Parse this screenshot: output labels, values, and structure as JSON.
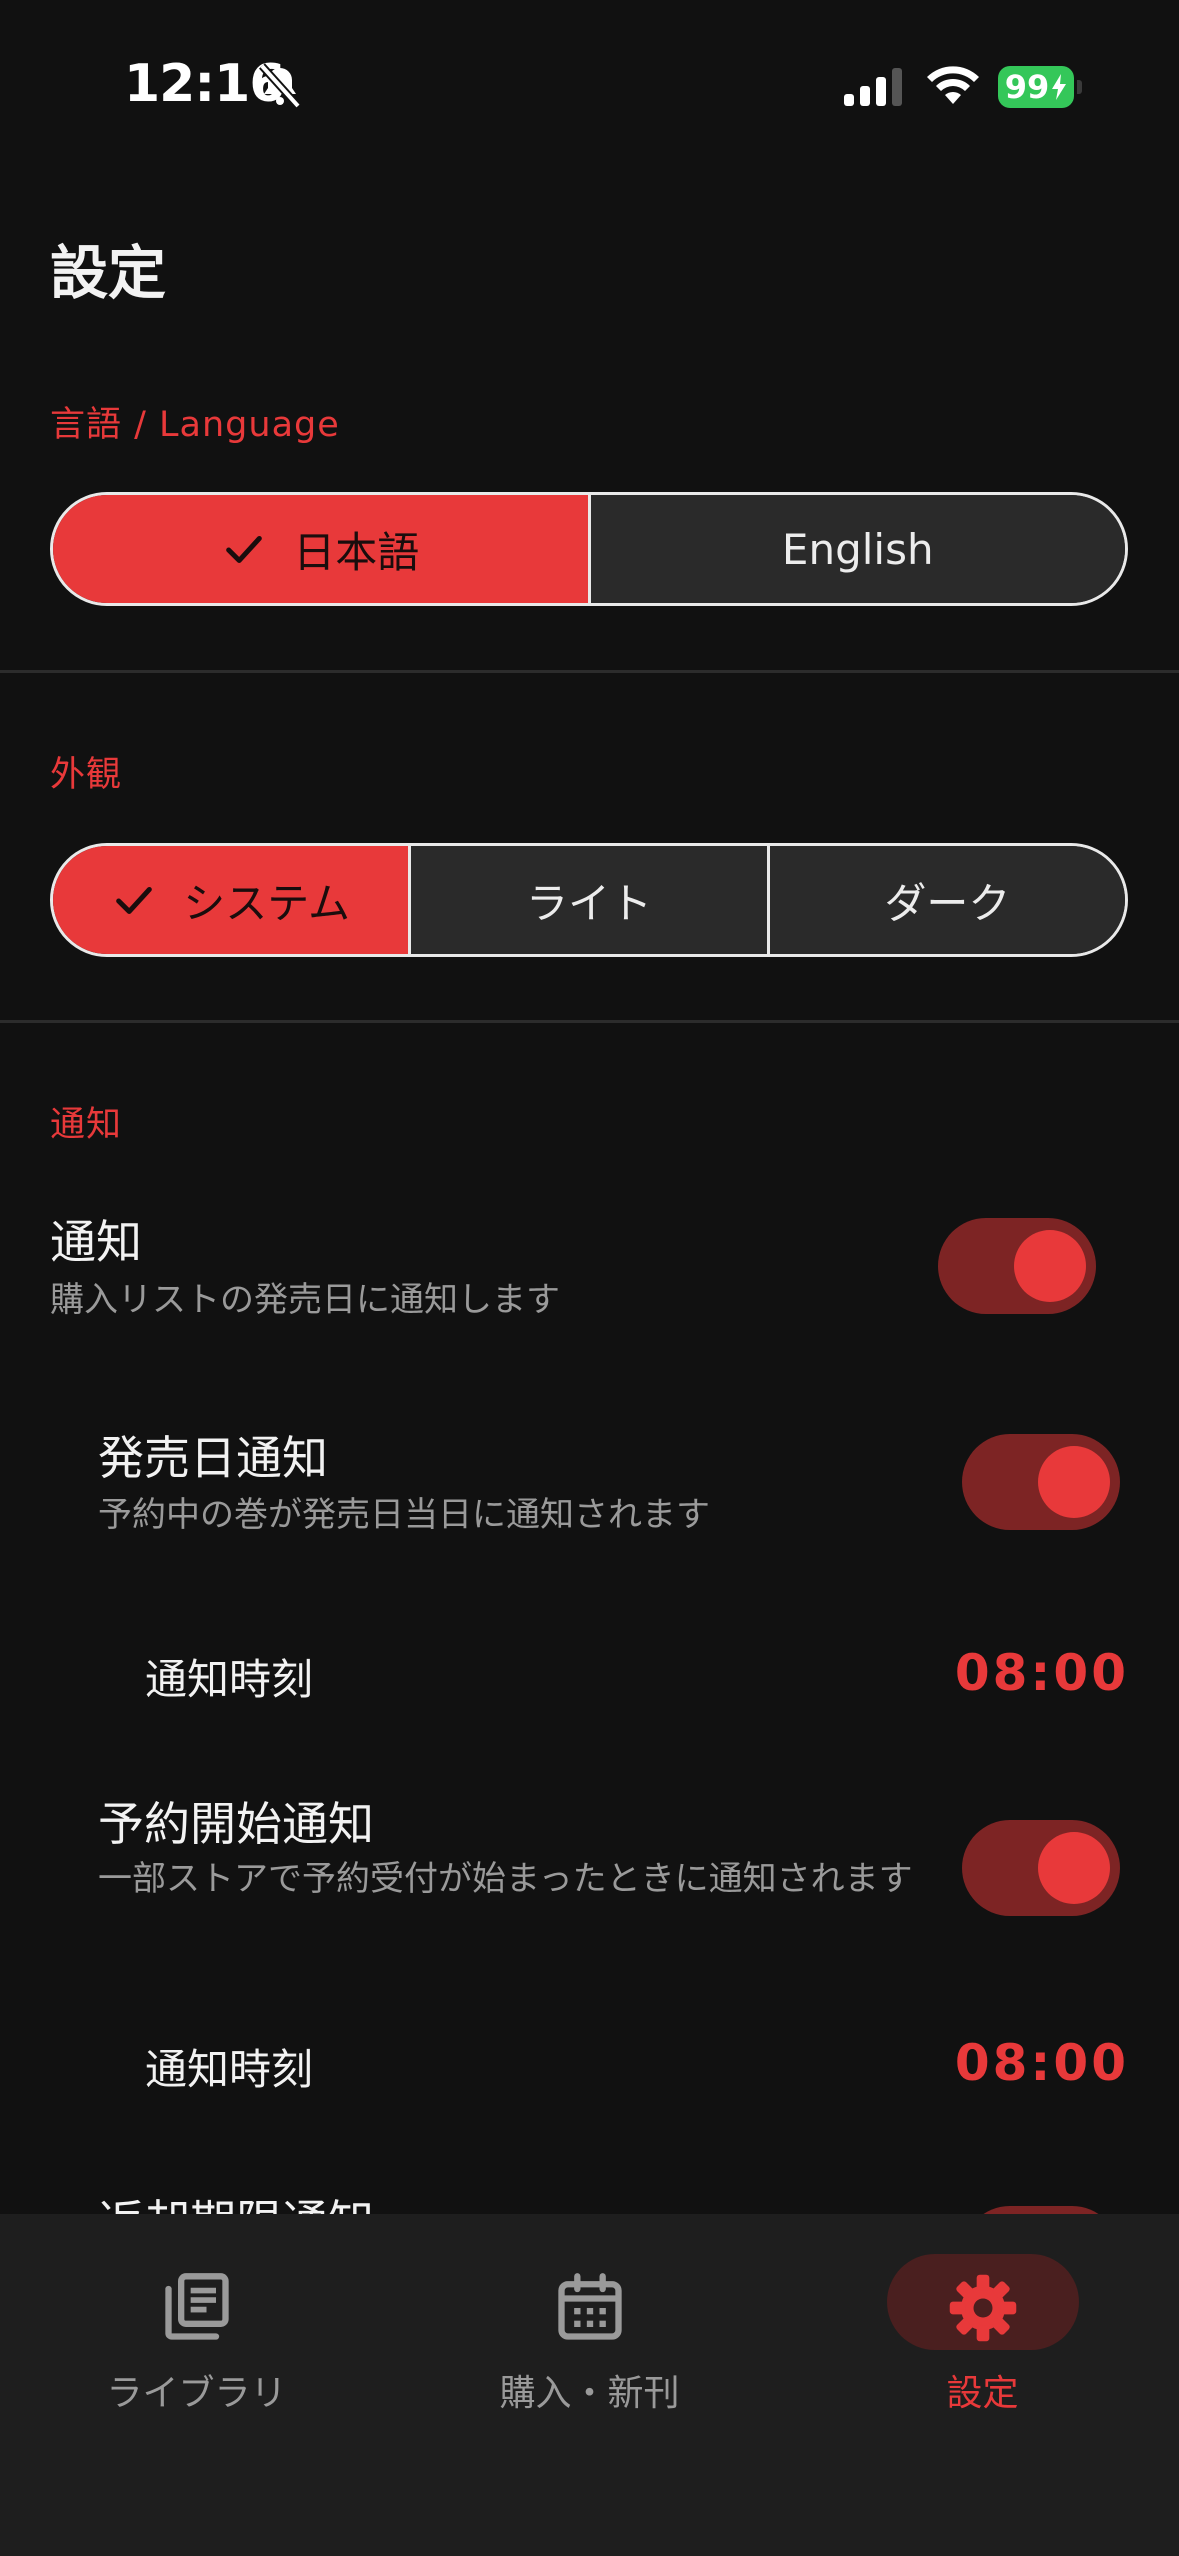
{
  "status_bar": {
    "time": "12:16",
    "battery": "99",
    "icons": [
      "bell-slash-icon",
      "cellular-signal-icon",
      "wifi-icon",
      "battery-charging-icon"
    ]
  },
  "page": {
    "title": "設定"
  },
  "language": {
    "label": "言語 / Language",
    "options": [
      {
        "label": "日本語",
        "selected": true
      },
      {
        "label": "English",
        "selected": false
      }
    ]
  },
  "appearance": {
    "label": "外観",
    "options": [
      {
        "label": "システム",
        "selected": true
      },
      {
        "label": "ライト",
        "selected": false
      },
      {
        "label": "ダーク",
        "selected": false
      }
    ]
  },
  "notifications": {
    "label": "通知",
    "main": {
      "title": "通知",
      "subtitle": "購入リストの発売日に通知します",
      "enabled": true
    },
    "release_day": {
      "title": "発売日通知",
      "subtitle": "予約中の巻が発売日当日に通知されます",
      "enabled": true
    },
    "release_time": {
      "label": "通知時刻",
      "value": "08:00"
    },
    "preorder": {
      "title": "予約開始通知",
      "subtitle": "一部ストアで予約受付が始まったときに通知されます",
      "enabled": true
    },
    "preorder_time": {
      "label": "通知時刻",
      "value": "08:00"
    },
    "partial_next": {
      "title": "返却期限通知"
    }
  },
  "bottom_nav": {
    "items": [
      {
        "label": "ライブラリ",
        "icon": "library-icon",
        "active": false
      },
      {
        "label": "購入・新刊",
        "icon": "calendar-icon",
        "active": false
      },
      {
        "label": "設定",
        "icon": "gear-icon",
        "active": true
      }
    ]
  },
  "colors": {
    "accent": "#e8393a",
    "background": "#111111",
    "toggle_track": "#7d2424",
    "nav_bg": "#1e1e1e"
  }
}
